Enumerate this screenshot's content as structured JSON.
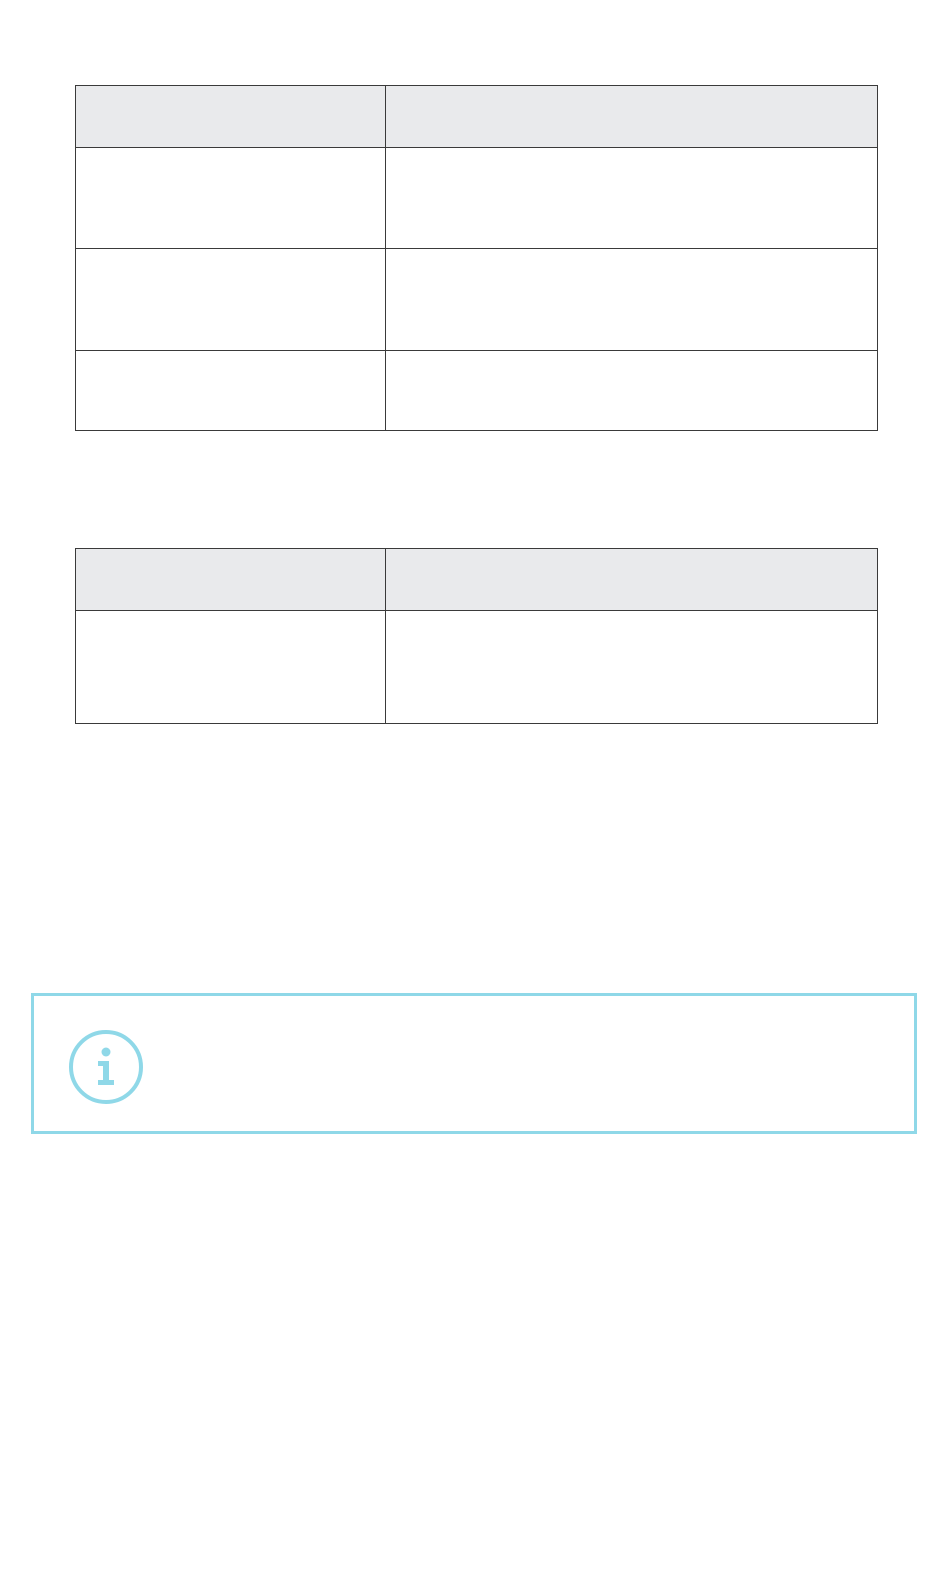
{
  "tables": [
    {
      "header": [
        "",
        ""
      ],
      "rows": [
        [
          "",
          ""
        ],
        [
          "",
          ""
        ],
        [
          "",
          ""
        ]
      ]
    },
    {
      "header": [
        "",
        ""
      ],
      "rows": [
        [
          "",
          ""
        ]
      ]
    }
  ],
  "info_box": {
    "icon": "info-icon",
    "text": "",
    "border_color": "#8fd8e8",
    "icon_color": "#8fd8e8"
  },
  "colors": {
    "table_header_bg": "#e9eaec",
    "table_border": "#3a3a3a"
  }
}
